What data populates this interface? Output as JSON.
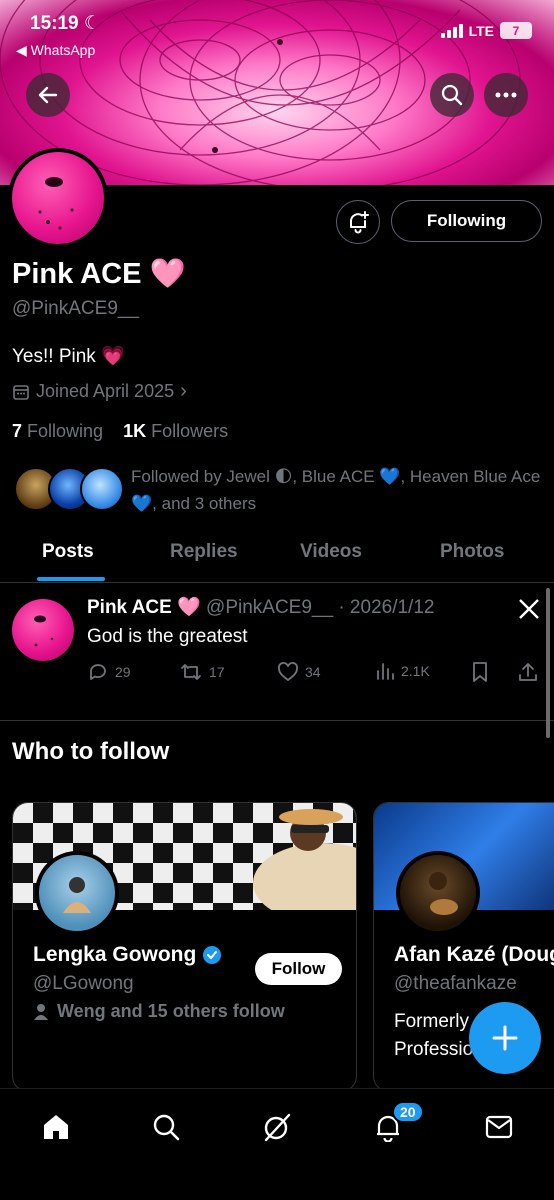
{
  "status_bar": {
    "time": "15:19",
    "back_app": "◀ WhatsApp",
    "network": "LTE",
    "battery": "7"
  },
  "profile": {
    "name": "Pink ACE 🩷",
    "handle": "@PinkACE9__",
    "bio": "Yes!! Pink 💗",
    "joined": "Joined April 2025",
    "following_count": "7",
    "following_label": "Following",
    "followers_count": "1K",
    "followers_label": "Followers",
    "following_button": "Following",
    "followed_by": "Followed by Jewel 🌓, Blue ACE 💙, Heaven Blue Ace 💙, and 3 others"
  },
  "tabs": [
    {
      "label": "Posts",
      "active": true
    },
    {
      "label": "Replies",
      "active": false
    },
    {
      "label": "Videos",
      "active": false
    },
    {
      "label": "Photos",
      "active": false
    }
  ],
  "post": {
    "author": "Pink ACE 🩷",
    "handle_date": "@PinkACE9__ · 2026/1/12",
    "text": "God is the greatest",
    "replies": "29",
    "reposts": "17",
    "likes": "34",
    "views": "2.1K"
  },
  "who_to_follow": {
    "title": "Who to follow",
    "cards": [
      {
        "name": "Lengka Gowong",
        "verified": true,
        "handle": "@LGowong",
        "meta": "Weng and 15 others follow",
        "follow_label": "Follow"
      },
      {
        "name": "Afan Kazé (Doug",
        "handle": "@theafankaze",
        "bio_line1": "Formerly ⊕ Ka",
        "bio_line2": "Professional sh"
      }
    ]
  },
  "bottom_nav": {
    "notifications_badge": "20",
    "items": [
      "home-icon",
      "search-icon",
      "grok-icon",
      "bell-icon",
      "mail-icon"
    ]
  },
  "colors": {
    "accent": "#1d9bf0",
    "pink": "#e8168f",
    "muted": "#71767b"
  }
}
